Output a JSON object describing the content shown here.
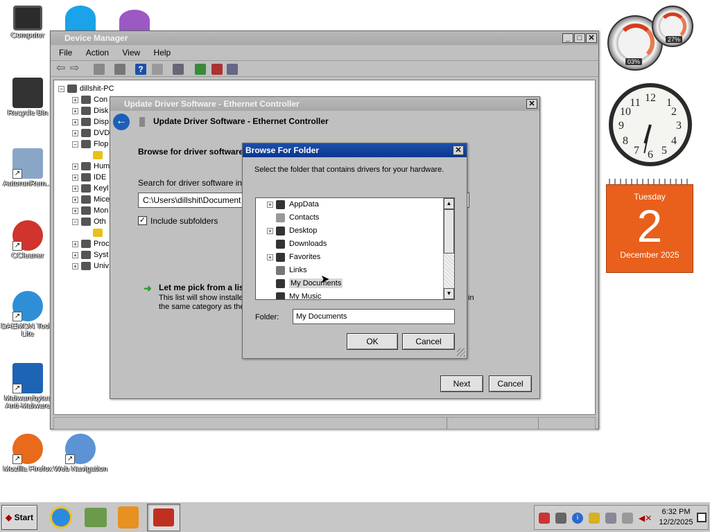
{
  "desktop": {
    "icons": [
      {
        "label": "Computer"
      },
      {
        "label": "Recycle Bin"
      },
      {
        "label": "AutorunRem..."
      },
      {
        "label": "CCleaner"
      },
      {
        "label": "DAEMON Tools Lite"
      },
      {
        "label": "Malwarebytes Anti-Malware"
      },
      {
        "label": "Mozilla Firefox"
      },
      {
        "label": "Web Navigation"
      }
    ]
  },
  "device_manager": {
    "title": "Device Manager",
    "menu": [
      "File",
      "Action",
      "View",
      "Help"
    ],
    "root": "dillshit-PC",
    "nodes": [
      "Con",
      "Disk",
      "Disp",
      "DVD",
      "Flop",
      "Hum",
      "IDE",
      "Keyl",
      "Mice",
      "Mon",
      "Oth",
      "Proc",
      "Syst",
      "Univ"
    ]
  },
  "update_driver": {
    "title": "Update Driver Software - Ethernet Controller",
    "header": "Update Driver Software - Ethernet Controller",
    "browse_heading": "Browse for driver software",
    "search_label": "Search for driver software in",
    "path_value": "C:\\Users\\dillshit\\Document",
    "include_subfolders": "Include subfolders",
    "pick_title": "Let me pick from a lis",
    "pick_desc_1": "This list will show installed",
    "pick_desc_2": "the same category as the",
    "pick_desc_tail": "in",
    "next_label": "Next",
    "cancel_label": "Cancel"
  },
  "browse_folder": {
    "title": "Browse For Folder",
    "instruction": "Select the folder that contains drivers for your hardware.",
    "items": [
      {
        "label": "AppData",
        "expandable": true
      },
      {
        "label": "Contacts",
        "expandable": false
      },
      {
        "label": "Desktop",
        "expandable": true
      },
      {
        "label": "Downloads",
        "expandable": false
      },
      {
        "label": "Favorites",
        "expandable": true
      },
      {
        "label": "Links",
        "expandable": false
      },
      {
        "label": "My Documents",
        "expandable": false,
        "selected": true
      },
      {
        "label": "My Music",
        "expandable": false
      }
    ],
    "folder_label": "Folder:",
    "folder_value": "My Documents",
    "ok_label": "OK",
    "cancel_label": "Cancel"
  },
  "gadgets": {
    "cpu_percent": "03%",
    "memory_percent": "27%",
    "clock": {
      "hour": 6,
      "minute": 32
    },
    "calendar": {
      "weekday": "Tuesday",
      "day": "2",
      "month_year": "December 2025"
    }
  },
  "taskbar": {
    "start_label": "Start",
    "time": "6:32 PM",
    "date": "12/2/2025"
  },
  "colors": {
    "active_title": "#0a3690",
    "calendar_orange": "#e8601c",
    "gauge_red": "#d83a1c"
  }
}
